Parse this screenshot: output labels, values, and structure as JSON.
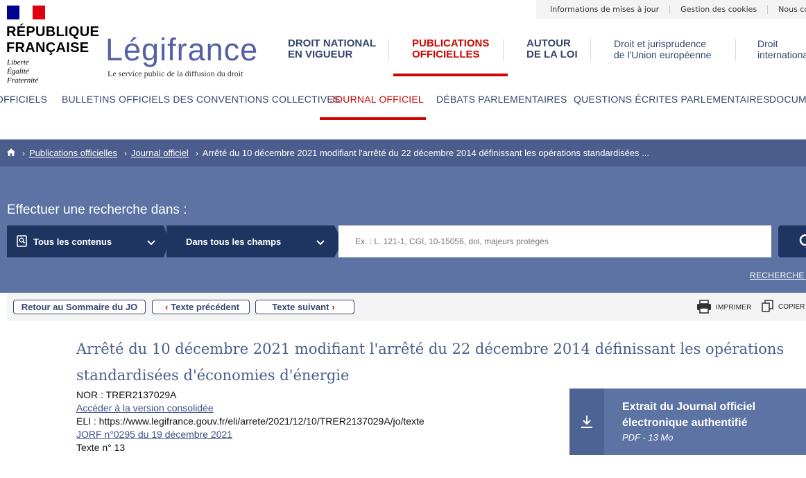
{
  "utility": {
    "links": [
      "Informations de mises à jour",
      "Gestion des cookies",
      "Nous contacter"
    ]
  },
  "logo": {
    "rf_line1": "RÉPUBLIQUE",
    "rf_line2": "FRANÇAISE",
    "devise": [
      "Liberté",
      "Égalité",
      "Fraternité"
    ],
    "brand": "Légifrance",
    "tagline": "Le service public de la diffusion du droit"
  },
  "main_nav": {
    "items": [
      {
        "line1": "DROIT NATIONAL",
        "line2": "EN VIGUEUR"
      },
      {
        "line1": "PUBLICATIONS",
        "line2": "OFFICIELLES"
      },
      {
        "line1": "AUTOUR",
        "line2": "DE LA LOI"
      },
      {
        "line1": "Droit et jurisprudence",
        "line2": "de l'Union européenne"
      },
      {
        "line1": "Droit",
        "line2": "international"
      }
    ]
  },
  "sub_nav": {
    "items": [
      "OFFICIELS",
      "BULLETINS OFFICIELS DES CONVENTIONS COLLECTIVES",
      "JOURNAL OFFICIEL",
      "DÉBATS PARLEMENTAIRES",
      "QUESTIONS ÉCRITES PARLEMENTAIRES",
      "DOCUMENTS"
    ]
  },
  "breadcrumb": {
    "items": [
      "Publications officielles",
      "Journal officiel"
    ],
    "current": "Arrêté du 10 décembre 2021 modifiant l'arrêté du 22 décembre 2014 définissant les opérations standardisées ..."
  },
  "search": {
    "title": "Effectuer une recherche dans :",
    "scope": "Tous les contenus",
    "field": "Dans tous les champs",
    "placeholder": "Ex. : L. 121-1, CGI, 10-15056, dol, majeurs protégés",
    "advanced": "RECHERCHE AVANCÉE"
  },
  "toolbar": {
    "back": "Retour au Sommaire du JO",
    "prev": "Texte précédent",
    "next": "Texte suivant",
    "print": "IMPRIMER",
    "copy": "COPIER LE TEXTE"
  },
  "document": {
    "title_line1": "Arrêté du 10 décembre 2021 modifiant l'arrêté du 22 décembre 2014 définissant les opérations",
    "title_line2": "standardisées d'économies d'énergie",
    "nor": "NOR : TRER2137029A",
    "consolidated": "Accéder à la version consolidée",
    "eli": "ELI : https://www.legifrance.gouv.fr/eli/arrete/2021/12/10/TRER2137029A/jo/texte",
    "jorf": "JORF n°0295 du 19 décembre 2021",
    "texte_no": "Texte n° 13"
  },
  "download": {
    "line1": "Extrait du Journal officiel",
    "line2": "électronique authentifié",
    "size": "PDF - 13 Mo"
  },
  "colors": {
    "accent_red": "#ce0500",
    "navy": "#1f3561",
    "band_blue": "#5c73a4",
    "brand_blue": "#5560a8"
  }
}
